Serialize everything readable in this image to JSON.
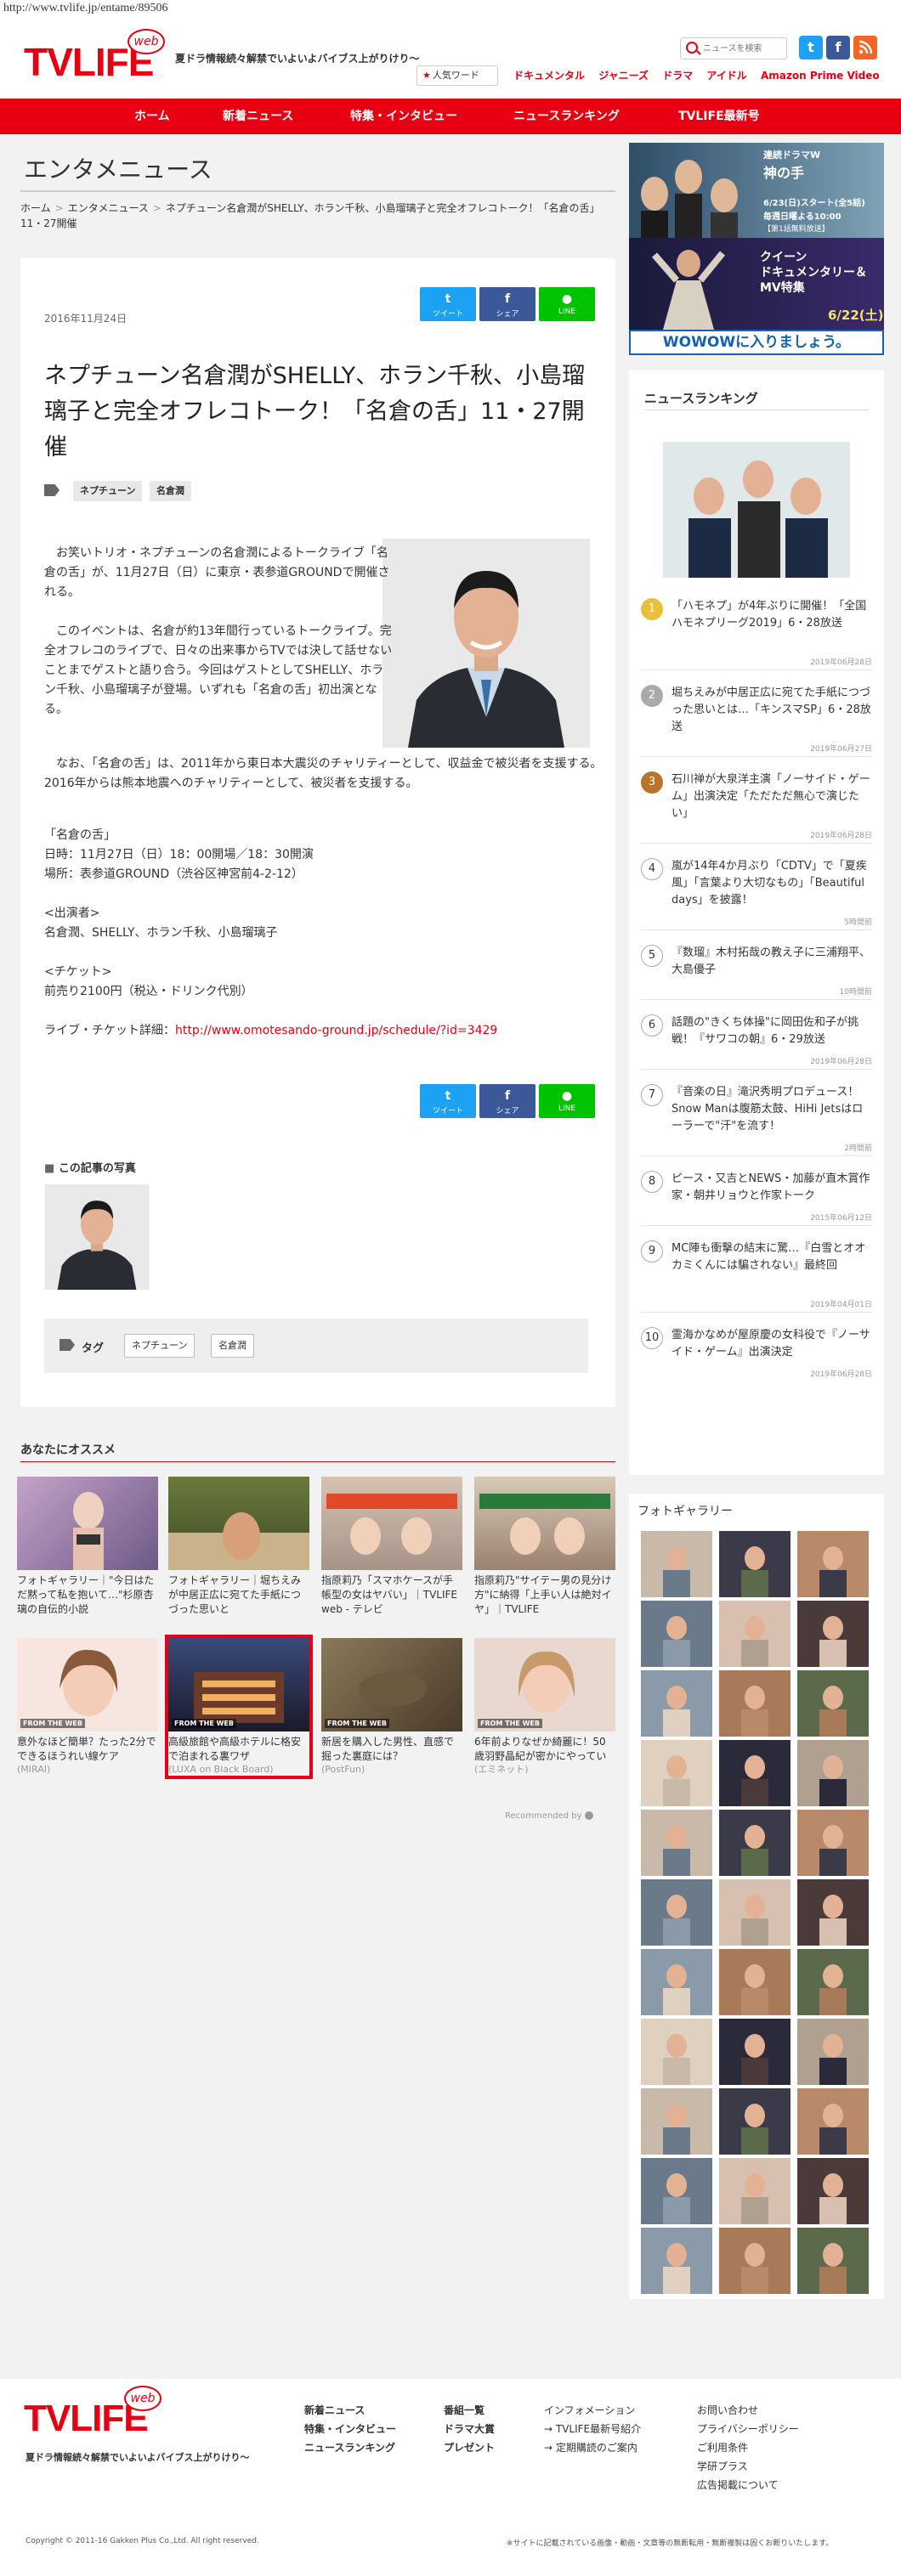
{
  "url": "http://www.tvlife.jp/entame/89506",
  "brand": {
    "logo": "TVLIFE",
    "web": "web",
    "tagline": "夏ドラ情報続々解禁でいよいよバイブス上がりけり〜"
  },
  "header": {
    "search_placeholder": "ニュースを検索",
    "popular_label": "人気ワード",
    "topnav": [
      "ドキュメンタル",
      "ジャニーズ",
      "ドラマ",
      "アイドル",
      "Amazon Prime Video"
    ]
  },
  "nav": [
    "ホーム",
    "新着ニュース",
    "特集・インタビュー",
    "ニュースランキング",
    "TVLIFE最新号"
  ],
  "section_title": "エンタメニュース",
  "breadcrumb": [
    "ホーム",
    "エンタメニュース",
    "ネプチューン名倉潤がSHELLY、ホラン千秋、小島瑠璃子と完全オフレコトーク！「名倉の舌」11・27開催"
  ],
  "article": {
    "date": "2016年11月24日",
    "share": {
      "tweet": "ツイート",
      "share": "シェア",
      "line": "LINE"
    },
    "title": "ネプチューン名倉潤がSHELLY、ホラン千秋、小島瑠璃子と完全オフレコトーク！「名倉の舌」11・27開催",
    "tags": [
      "ネプチューン",
      "名倉潤"
    ],
    "p1": "　お笑いトリオ・ネプチューンの名倉潤によるトークライブ「名倉の舌」が、11月27日（日）に東京・表参道GROUNDで開催される。",
    "p2": "　このイベントは、名倉が約13年間行っているトークライブ。完全オフレコのライブで、日々の出来事からTVでは決して話せないことまでゲストと語り合う。今回はゲストとしてSHELLY、ホラン千秋、小島瑠璃子が登場。いずれも「名倉の舌」初出演となる。",
    "p3": "　なお、「名倉の舌」は、2011年から東日本大震災のチャリティーとして、収益金で被災者を支援する。2016年からは熊本地震へのチャリティーとして、被災者を支援する。",
    "event_title": "「名倉の舌」",
    "event_date": "日時：11月27日（日）18：00開場／18：30開演",
    "event_place": "場所：表参道GROUND（渋谷区神宮前4-2-12）",
    "cast_title": "<出演者>",
    "cast": "名倉潤、SHELLY、ホラン千秋、小島瑠璃子",
    "ticket_title": "<チケット>",
    "ticket": "前売り2100円（税込・ドリンク代別）",
    "link_label": "ライブ・チケット詳細：",
    "link_url": "http://www.omotesando-ground.jp/schedule/?id=3429",
    "photos_title": "この記事の写真",
    "tag_label": "タグ"
  },
  "recommend": {
    "title": "あなたにオススメ",
    "items": [
      {
        "caption": "フォトギャラリー｜\"今日はただ黙って私を抱いて…\"杉原杏璃の自伝的小説",
        "source": ""
      },
      {
        "caption": "フォトギャラリー｜堀ちえみが中居正広に宛てた手紙につづった思いと",
        "source": ""
      },
      {
        "caption": "指原莉乃「スマホケースが手帳型の女はヤバい」｜TVLIFE web - テレビ",
        "source": ""
      },
      {
        "caption": "指原莉乃\"サイテー男の見分け方\"に納得「上手い人は絶対イヤ」｜TVLIFE",
        "source": ""
      },
      {
        "caption": "意外なほど簡単？たった2分でできるほうれい線ケア",
        "source": "(MIRAI)",
        "badge": "FROM THE WEB"
      },
      {
        "caption": "高級旅館や高級ホテルに格安で泊まれる裏ワザ",
        "source": "(LUXA on Black Board)",
        "badge": "FROM THE WEB"
      },
      {
        "caption": "新居を購入した男性、直感で掘った裏庭には？",
        "source": "(PostFun)",
        "badge": "FROM THE WEB"
      },
      {
        "caption": "6年前よりなぜか綺麗に！50歳羽野晶紀が密かにやっている若見せ術",
        "source": "(エミネット)",
        "badge": "FROM THE WEB"
      }
    ],
    "recommended_by": "Recommended by"
  },
  "sidebar": {
    "ad": {
      "line1": "連続ドラマW",
      "line2": "神の手",
      "date1": "6/23(日)スタート(全5話)",
      "date2": "毎週日曜よる10:00",
      "note": "【第1話無料放送】",
      "line3": "クイーン",
      "line4": "ドキュメンタリー＆",
      "line5": "MV特集",
      "date3": "6/22(土)",
      "cta": "WOWOWに入りましょう。"
    },
    "ranking_title": "ニュースランキング",
    "ranking": [
      {
        "n": "1",
        "text": "「ハモネプ」が4年ぶりに開催！「全国ハモネプリーグ2019」6・28放送",
        "date": "2019年06月28日"
      },
      {
        "n": "2",
        "text": "堀ちえみが中居正広に宛てた手紙につづった思いとは…「キンスマSP」6・28放送",
        "date": "2019年06月27日"
      },
      {
        "n": "3",
        "text": "石川禅が大泉洋主演「ノーサイド・ゲーム」出演決定「ただただ無心で演じたい」",
        "date": "2019年06月28日"
      },
      {
        "n": "4",
        "text": "嵐が14年4か月ぶり「CDTV」で「夏疾風」「言葉より大切なもの」「Beautiful days」を披露！",
        "date": "5時間前"
      },
      {
        "n": "5",
        "text": "『数瑠』木村拓哉の教え子に三浦翔平、大島優子",
        "date": "10時間前"
      },
      {
        "n": "6",
        "text": "話題の\"きくち体操\"に岡田佐和子が挑戦！『サワコの朝』6・29放送",
        "date": "2019年06月28日"
      },
      {
        "n": "7",
        "text": "『音楽の日』滝沢秀明プロデュース！Snow Manは腹筋太鼓、HiHi Jetsはローラーで\"汗\"を流す！",
        "date": "2時間前"
      },
      {
        "n": "8",
        "text": "ピース・又吉とNEWS・加藤が直木賞作家・朝井リョウと作家トーク",
        "date": "2015年06月12日"
      },
      {
        "n": "9",
        "text": "MC陣も衝撃の結末に驚…『白雪とオオカミくんには騙されない』最終回",
        "date": "2019年04月01日"
      },
      {
        "n": "10",
        "text": "霊海かなめが屋原慶の女科役で『ノーサイド・ゲーム』出演決定",
        "date": "2019年06月28日"
      }
    ],
    "gallery_title": "フォトギャラリー"
  },
  "footer": {
    "col1": [
      "新着ニュース",
      "特集・インタビュー",
      "ニュースランキング"
    ],
    "col2": [
      "番組一覧",
      "ドラマ大賞",
      "プレゼント"
    ],
    "col3_title": "インフォメーション",
    "col3": [
      "TVLIFE最新号紹介",
      "定期購読のご案内"
    ],
    "col4": [
      "お問い合わせ",
      "プライバシーポリシー",
      "ご利用条件",
      "学研プラス",
      "広告掲載について"
    ],
    "copyright": "Copyright © 2011-16 Gakken Plus Co.,Ltd. All right reserved.",
    "disclaimer": "※サイトに記載されている画像・動画・文章等の無断転用・無断複製は固くお断りいたします。"
  },
  "colors": {
    "brand": "#e60012",
    "twitter": "#1da1f2",
    "facebook": "#3b5998",
    "line": "#00c300"
  }
}
